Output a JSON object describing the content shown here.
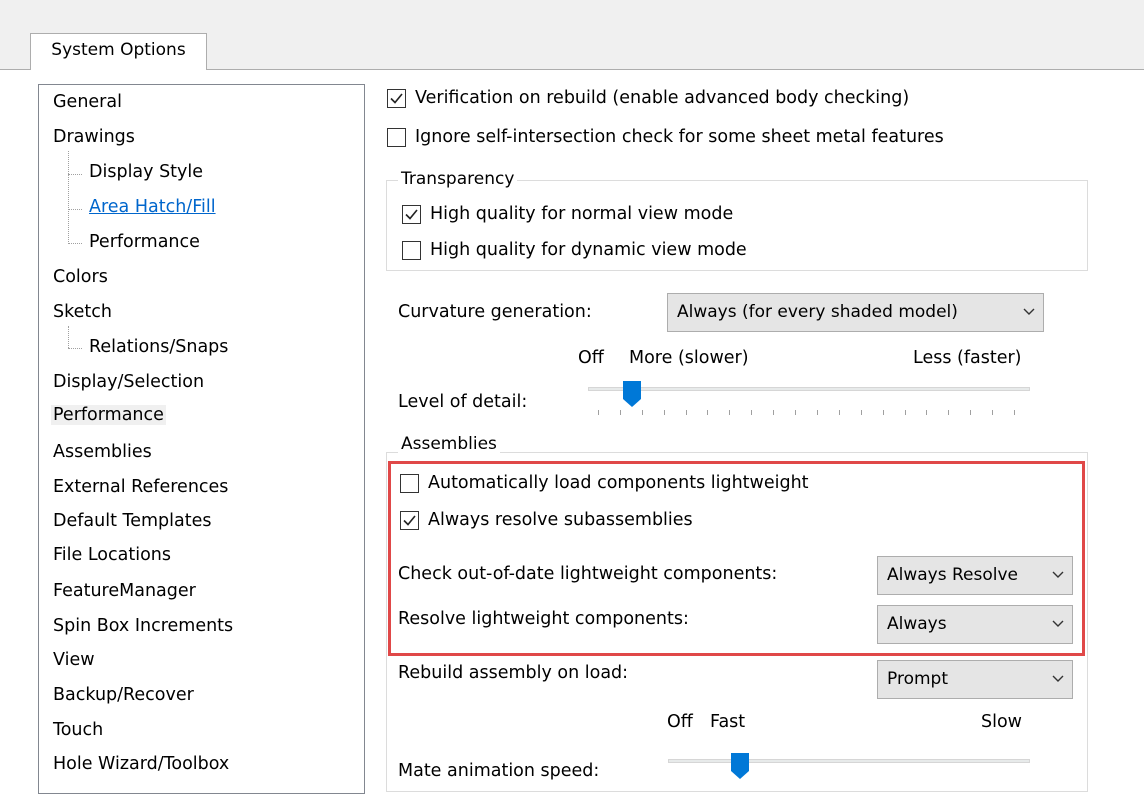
{
  "tab": {
    "label": "System Options"
  },
  "tree": {
    "items": [
      {
        "label": "General"
      },
      {
        "label": "Drawings"
      },
      {
        "label": "Display Style"
      },
      {
        "label": "Area Hatch/Fill"
      },
      {
        "label": "Performance"
      },
      {
        "label": "Colors"
      },
      {
        "label": "Sketch"
      },
      {
        "label": "Relations/Snaps"
      },
      {
        "label": "Display/Selection"
      },
      {
        "label": "Performance"
      },
      {
        "label": "Assemblies"
      },
      {
        "label": "External References"
      },
      {
        "label": "Default Templates"
      },
      {
        "label": "File Locations"
      },
      {
        "label": "FeatureManager"
      },
      {
        "label": "Spin Box Increments"
      },
      {
        "label": "View"
      },
      {
        "label": "Backup/Recover"
      },
      {
        "label": "Touch"
      },
      {
        "label": "Hole Wizard/Toolbox"
      }
    ],
    "selected": "Performance",
    "link_item": "Area Hatch/Fill"
  },
  "options": {
    "verification": {
      "label": "Verification on rebuild (enable advanced body checking)",
      "checked": true
    },
    "ignore_self_intersection": {
      "label": "Ignore self-intersection check for some sheet metal features",
      "checked": false
    }
  },
  "transparency": {
    "title": "Transparency",
    "normal": {
      "label": "High quality for normal view mode",
      "checked": true
    },
    "dynamic": {
      "label": "High quality for dynamic view mode",
      "checked": false
    }
  },
  "curvature": {
    "label": "Curvature generation:",
    "value": "Always (for every shaded model)"
  },
  "level_of_detail": {
    "label": "Level of detail:",
    "off": "Off",
    "more": "More (slower)",
    "less": "Less (faster)",
    "level": 0.08
  },
  "assemblies": {
    "title": "Assemblies",
    "auto_lightweight": {
      "label": "Automatically load components lightweight",
      "checked": false
    },
    "resolve_sub": {
      "label": "Always resolve subassemblies",
      "checked": true
    },
    "check_out_of_date": {
      "label": "Check out-of-date lightweight components:",
      "value": "Always Resolve"
    },
    "resolve_lightweight": {
      "label": "Resolve lightweight components:",
      "value": "Always"
    },
    "rebuild_on_load": {
      "label": "Rebuild assembly on load:",
      "value": "Prompt"
    }
  },
  "mate_animation": {
    "label": "Mate animation speed:",
    "off": "Off",
    "fast": "Fast",
    "slow": "Slow",
    "level": 0.18
  },
  "colors": {
    "highlight": "#e04848",
    "link": "#0066cc",
    "slider_thumb": "#0078d7"
  }
}
